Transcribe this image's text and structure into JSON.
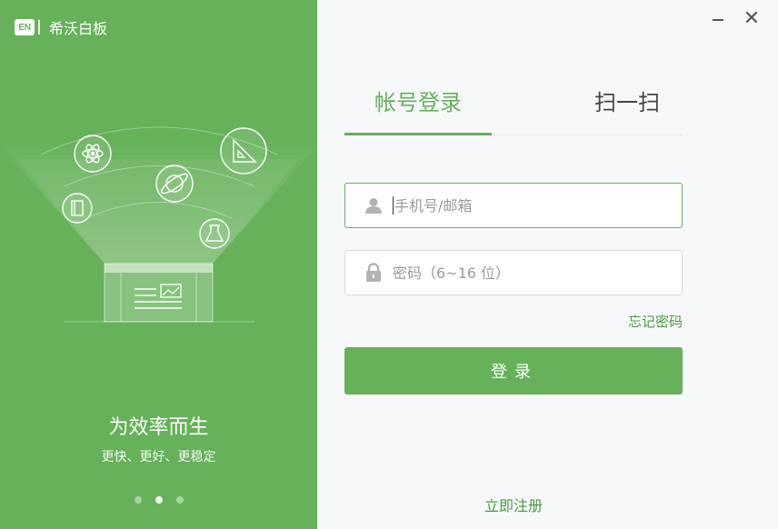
{
  "window": {
    "app_name": "希沃白板",
    "logo_text": "EN",
    "minimize_icon": "minimize-icon",
    "close_glyph": "✕"
  },
  "left_panel": {
    "background_color": "#66b15a",
    "illustration_icons": [
      "atom-icon",
      "planet-icon",
      "ruler-triangle-icon",
      "book-icon",
      "flask-icon",
      "whiteboard-icon"
    ],
    "slogan": "为效率而生",
    "sub_slogan": "更快、更好、更稳定",
    "carousel": {
      "total": 3,
      "active_index": 1
    }
  },
  "tabs": [
    {
      "label": "帐号登录",
      "active": true
    },
    {
      "label": "扫一扫",
      "active": false
    }
  ],
  "form": {
    "phone": {
      "placeholder": "手机号/邮箱",
      "value": "",
      "icon": "user-icon"
    },
    "password": {
      "placeholder": "密码（6~16 位）",
      "value": "",
      "icon": "lock-icon"
    },
    "forgot_label": "忘记密码",
    "login_label": "登录",
    "register_label": "立即注册"
  },
  "colors": {
    "accent": "#66b15a",
    "link": "#4c9a40"
  }
}
